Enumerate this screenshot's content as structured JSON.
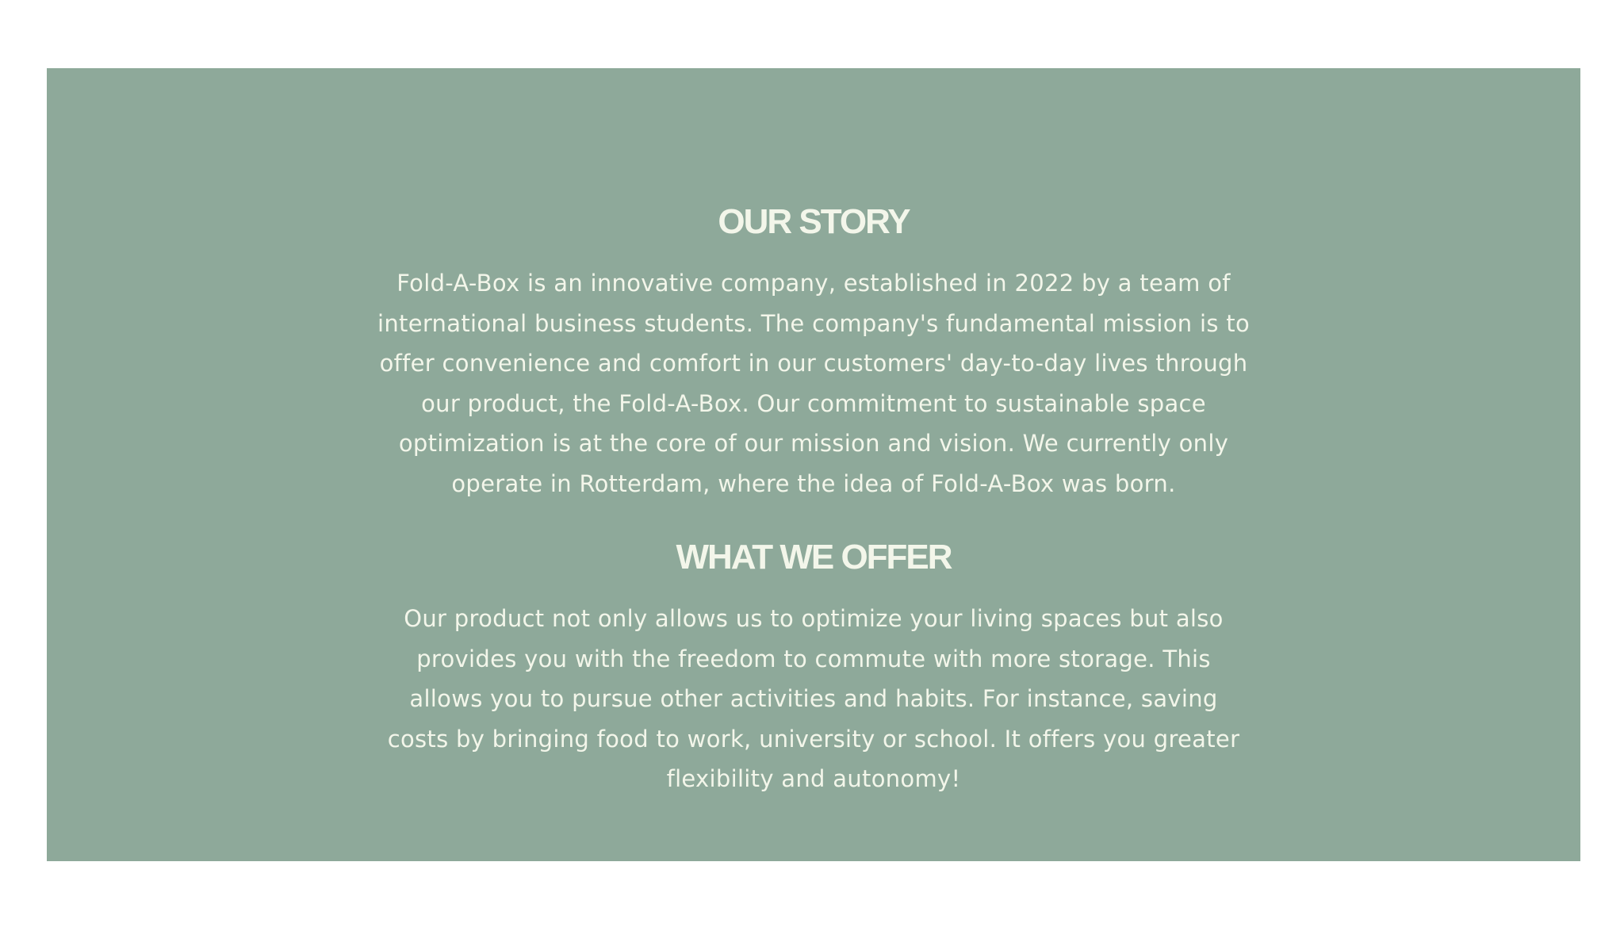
{
  "colors": {
    "page_background": "#ffffff",
    "panel_background": "#8ea99a",
    "text": "#f3f6ea"
  },
  "story": {
    "title": "OUR STORY",
    "body": "Fold-A-Box is an innovative company, established in 2022 by a team of international business students. The company's fundamental mission is to offer convenience and comfort in our customers' day-to-day lives through our product, the Fold-A-Box. Our commitment to sustainable space optimization is at the core of our mission and vision. We currently only operate in Rotterdam, where the idea of Fold-A-Box was born."
  },
  "offer": {
    "title": "WHAT WE OFFER",
    "body": "Our product not only allows us to optimize your living spaces but also provides you with the freedom to commute with more storage. This allows you to pursue other activities and habits. For instance, saving costs by bringing food to work, university or school. It offers you greater flexibility and autonomy!"
  }
}
